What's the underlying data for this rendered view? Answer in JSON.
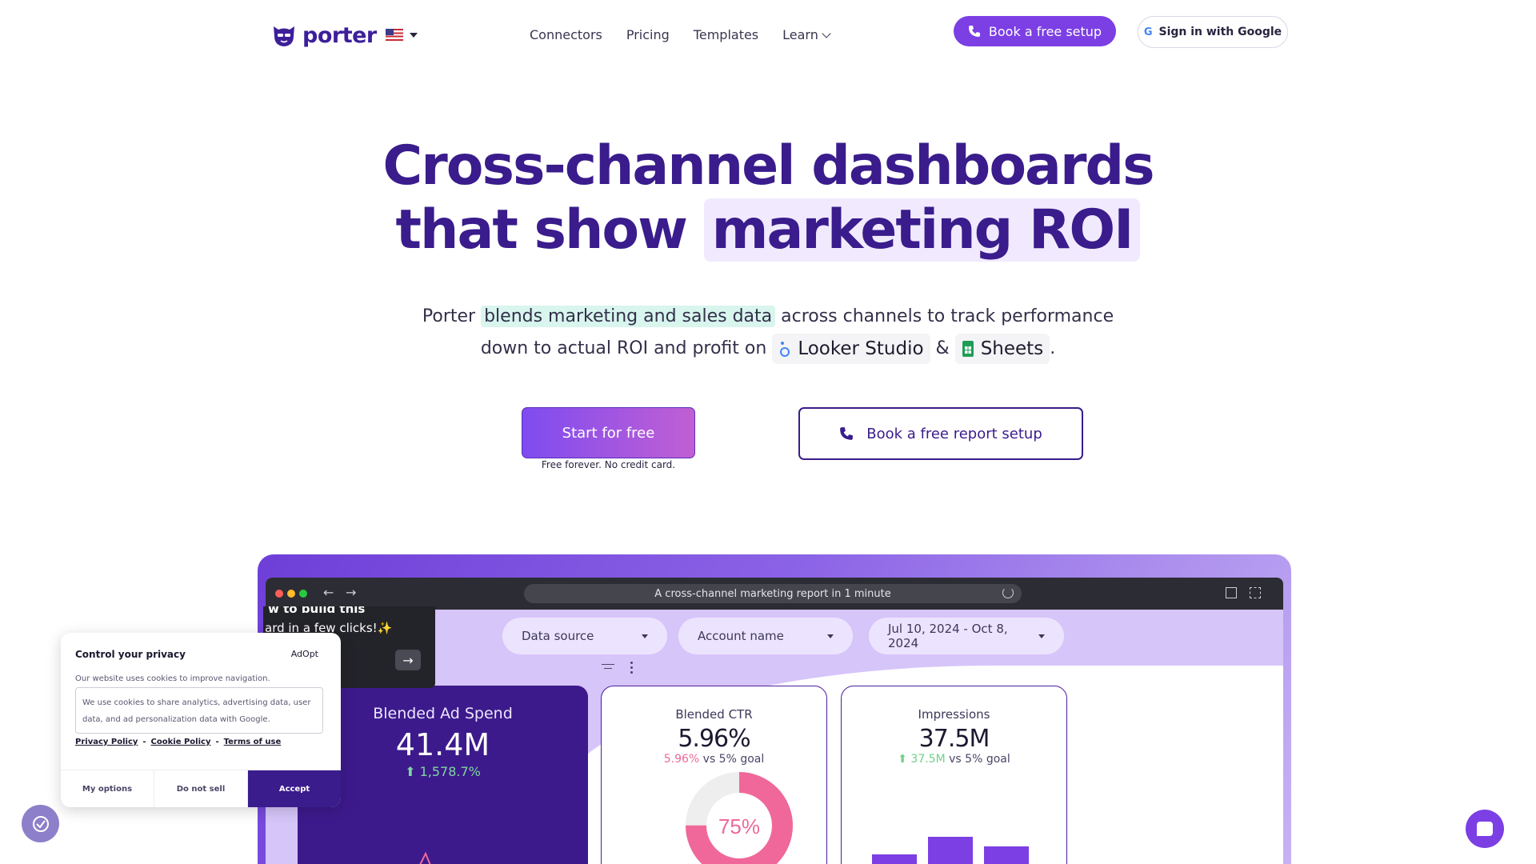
{
  "nav": {
    "brand": "porter",
    "links": [
      "Connectors",
      "Pricing",
      "Templates",
      "Learn"
    ],
    "book_label": "Book a free setup",
    "google_label": "Sign in with Google",
    "google_letter": "G"
  },
  "hero": {
    "title_line1": "Cross-channel dashboards",
    "title_line2_plain": "that show ",
    "title_line2_highlight": "marketing ROI",
    "sub_1": "Porter ",
    "sub_highlight": "blends marketing and sales data",
    "sub_2": " across channels to track performance",
    "sub_3": "down to actual ROI and profit on ",
    "chip_looker": "Looker Studio",
    "amp": "&",
    "chip_sheets": "Sheets",
    "period": ".",
    "start_label": "Start for free",
    "start_note": "Free forever. No credit card.",
    "report_label": "Book a free report setup"
  },
  "preview": {
    "url": "A cross-channel marketing report in 1 minute",
    "tooltip_line1": "w to build this",
    "tooltip_line2": "ard in a few clicks!✨",
    "tooltip_arrow": "→",
    "filters": {
      "data_source": "Data source",
      "account_name": "Account name",
      "date_range": "Jul 10, 2024 - Oct 8, 2024"
    },
    "ad_spend": {
      "title": "Blended Ad Spend",
      "value": "41.4M",
      "change": "⬆ 1,578.7%"
    },
    "ctr": {
      "title": "Blended CTR",
      "value": "5.96%",
      "goal_val": "5.96%",
      "goal_text": " vs 5% goal",
      "donut_label": "75%",
      "donut_fraction": 0.75
    },
    "impressions": {
      "title": "Impressions",
      "value": "37.5M",
      "goal_val": "⬆ 37.5M",
      "goal_text": " vs 5% goal"
    }
  },
  "cookie": {
    "title": "Control your privacy",
    "brand": "AdOpt",
    "line": "Our website uses cookies to improve navigation.",
    "box": "We use cookies to share analytics, advertising data, user data, and ad personalization data with Google.",
    "privacy": "Privacy Policy",
    "cookie_policy": "Cookie Policy",
    "terms": "Terms of use",
    "sep": "-",
    "btn_options": "My options",
    "btn_notsell": "Do not sell",
    "btn_accept": "Accept"
  },
  "colors": {
    "brand": "#3a1c8c",
    "accent": "#7b3fe4",
    "pink": "#f0689a",
    "green": "#6fcf8a"
  }
}
